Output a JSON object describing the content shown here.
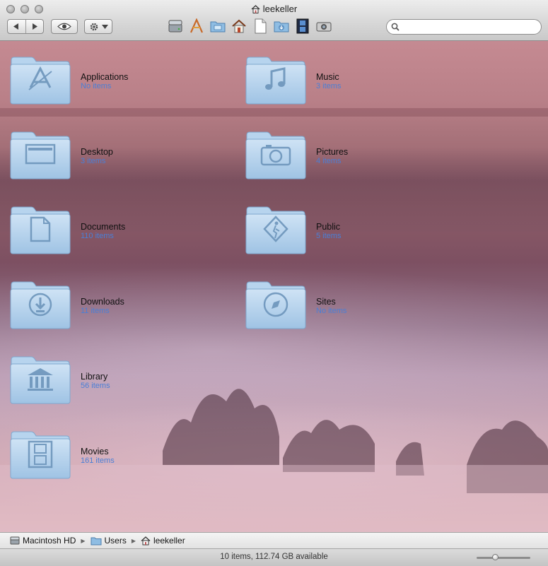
{
  "window": {
    "title": "leekeller"
  },
  "toolbar": {
    "search_placeholder": "",
    "icons": [
      "hard-drive-icon",
      "applications-icon",
      "desktop-icon",
      "home-icon",
      "document-icon",
      "downloads-icon",
      "movies-icon",
      "camera-icon"
    ]
  },
  "items": [
    {
      "name": "Applications",
      "count": "No items",
      "glyph": "applications"
    },
    {
      "name": "Desktop",
      "count": "3 items",
      "glyph": "desktop"
    },
    {
      "name": "Documents",
      "count": "110 items",
      "glyph": "documents"
    },
    {
      "name": "Downloads",
      "count": "11 items",
      "glyph": "downloads"
    },
    {
      "name": "Library",
      "count": "56 items",
      "glyph": "library"
    },
    {
      "name": "Movies",
      "count": "161 items",
      "glyph": "movies"
    },
    {
      "name": "Music",
      "count": "3 items",
      "glyph": "music"
    },
    {
      "name": "Pictures",
      "count": "4 items",
      "glyph": "pictures"
    },
    {
      "name": "Public",
      "count": "5 items",
      "glyph": "public"
    },
    {
      "name": "Sites",
      "count": "No items",
      "glyph": "sites"
    }
  ],
  "pathbar": {
    "disk": "Macintosh HD",
    "users": "Users",
    "home": "leekeller"
  },
  "status": {
    "text": "10 items, 112.74 GB available",
    "zoom_fraction": 0.33
  },
  "colors": {
    "count_text": "#4a7fd6",
    "folder": "#a9cbe8"
  }
}
